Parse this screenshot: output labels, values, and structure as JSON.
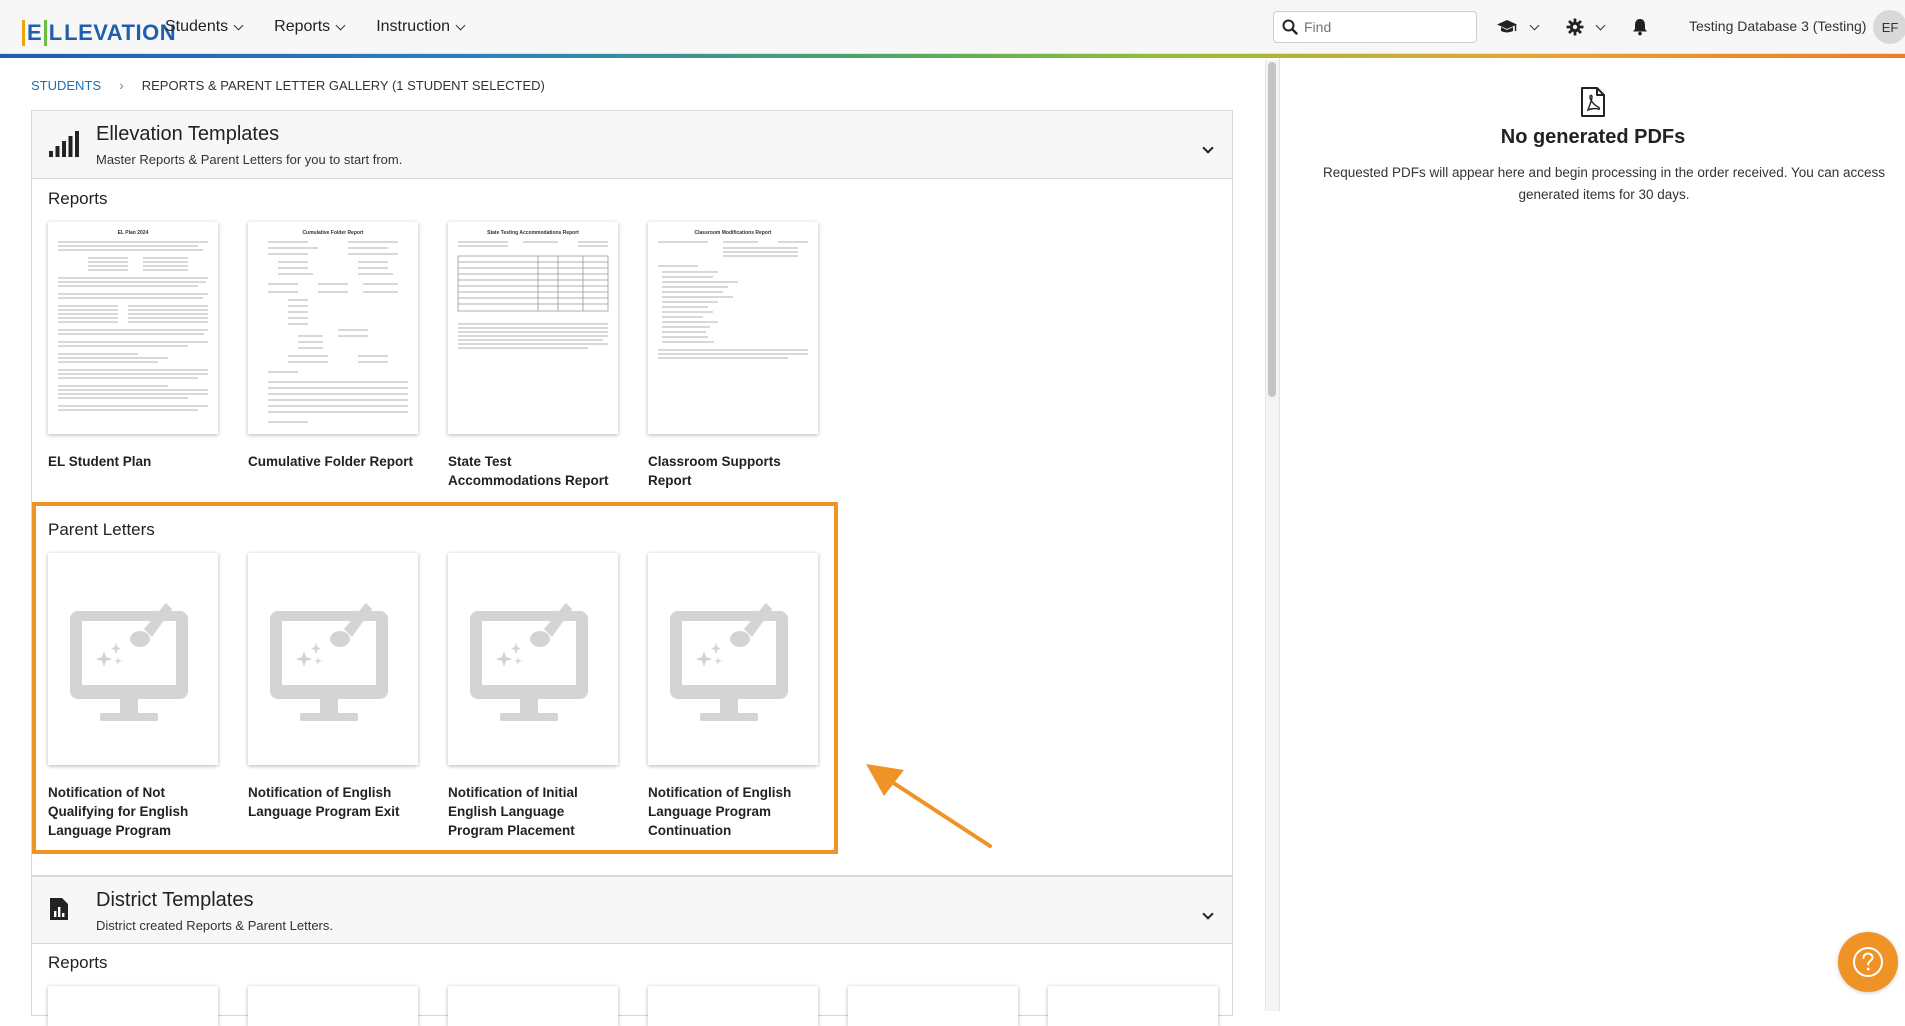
{
  "app": {
    "logo_text": "ELLEVATION",
    "nav_menu": [
      {
        "label": "Students"
      },
      {
        "label": "Reports"
      },
      {
        "label": "Instruction"
      }
    ],
    "search_placeholder": "Find",
    "database_name": "Testing Database 3 (Testing)",
    "user_initials": "EF"
  },
  "breadcrumb": {
    "students_link": "STUDENTS",
    "separator": "›",
    "current": "REPORTS & PARENT LETTER GALLERY (1 STUDENT SELECTED)"
  },
  "ellevation_templates": {
    "title": "Ellevation Templates",
    "subtitle": "Master Reports & Parent Letters for you to start from.",
    "reports_heading": "Reports",
    "reports": [
      {
        "label": "EL Student Plan",
        "thumb_title": "EL Plan 2024"
      },
      {
        "label": "Cumulative Folder Report",
        "thumb_title": "Cumulative Folder Report"
      },
      {
        "label": "State Test Accommodations Report",
        "thumb_title": "State Testing Accommodations Report"
      },
      {
        "label": "Classroom Supports Report",
        "thumb_title": "Classroom Modifications Report"
      }
    ],
    "parent_letters_heading": "Parent Letters",
    "parent_letters": [
      {
        "label": "Notification of Not Qualifying for English Language Program"
      },
      {
        "label": "Notification of English Language Program Exit"
      },
      {
        "label": "Notification of Initial English Language Program Placement"
      },
      {
        "label": "Notification of English Language Program Continuation"
      }
    ]
  },
  "district_templates": {
    "title": "District Templates",
    "subtitle": "District created Reports & Parent Letters.",
    "reports_heading": "Reports"
  },
  "pdf_panel": {
    "title": "No generated PDFs",
    "description": "Requested PDFs will appear here and begin processing in the order received. You can access generated items for 30 days."
  },
  "icons": {
    "search": "search-icon",
    "graduation_cap": "graduation-cap-icon",
    "settings": "gear-icon",
    "notifications": "bell-icon",
    "pdf": "pdf-file-icon",
    "help": "question-icon",
    "signal_bars": "signal-bars-icon",
    "chart_doc": "chart-document-icon",
    "letter_placeholder": "monitor-paint-icon"
  },
  "colors": {
    "accent_orange": "#ef9327",
    "link_blue": "#1f6fb2",
    "brand_blue": "#1f5fae"
  }
}
